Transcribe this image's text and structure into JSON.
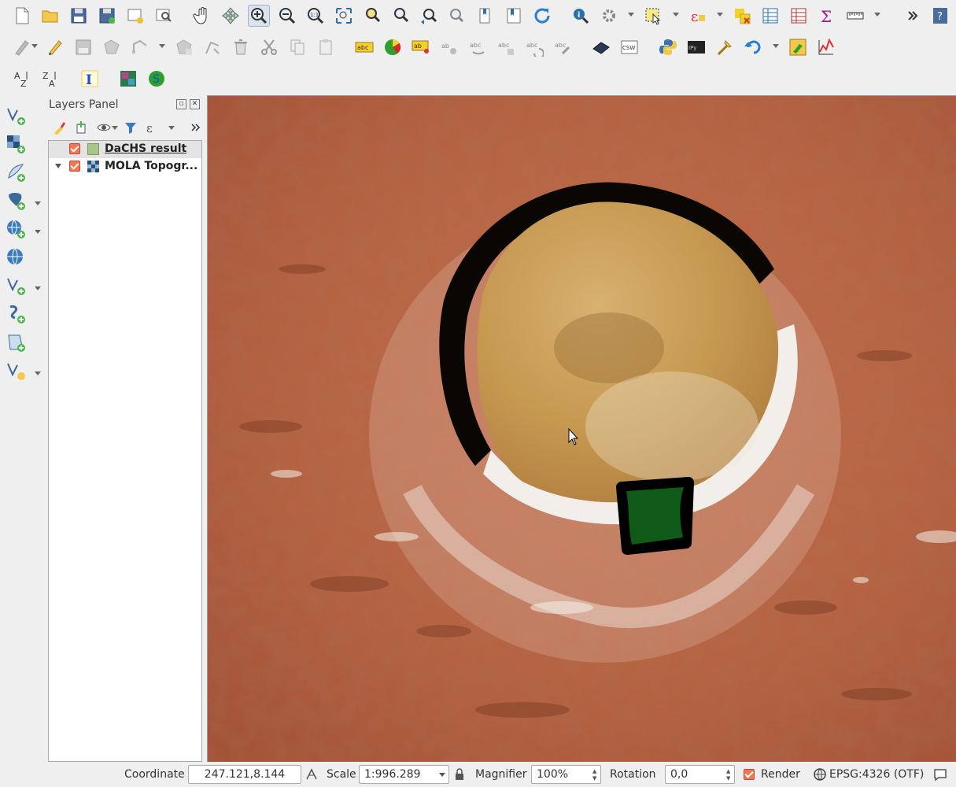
{
  "layers_panel": {
    "title": "Layers Panel",
    "layers": [
      {
        "name": "DaCHS result",
        "visible": true,
        "symbol_color": "#a8c68a",
        "selected": true
      },
      {
        "name": "MOLA Topogr...",
        "visible": true,
        "symbol": "raster-icon",
        "expanded": true
      }
    ]
  },
  "statusbar": {
    "coordinate_label": "Coordinate",
    "coordinate_value": "247.121,8.144",
    "scale_label": "Scale",
    "scale_value": "1:996.289",
    "magnifier_label": "Magnifier",
    "magnifier_value": "100%",
    "rotation_label": "Rotation",
    "rotation_value": "0,0",
    "render_label": "Render",
    "render_checked": true,
    "crs_label": "EPSG:4326 (OTF)"
  },
  "colors": {
    "terrain": "#b05a3c",
    "crater_floor": "#c79a52",
    "polygon_fill": "#0e5a18",
    "polygon_stroke": "#000000",
    "checkbox": "#f3784d"
  },
  "toolbars": {
    "row1_icons": [
      "new-project-icon",
      "open-project-icon",
      "save-project-icon",
      "save-as-icon",
      "new-print-layout-icon",
      "layout-manager-icon",
      "pan-icon",
      "pan-to-selection-icon",
      "zoom-in-icon",
      "zoom-out-icon",
      "zoom-native-icon",
      "zoom-full-icon",
      "zoom-to-selection-icon",
      "zoom-to-layer-icon",
      "zoom-last-icon",
      "zoom-next-icon",
      "new-bookmark-icon",
      "show-bookmarks-icon",
      "refresh-icon",
      "identify-icon",
      "action-icon",
      "select-features-icon",
      "select-by-expression-icon",
      "deselect-icon",
      "attribute-table-icon",
      "field-calculator-icon",
      "statistics-icon",
      "measure-icon",
      "more-icon",
      "help-icon"
    ],
    "row2_icons": [
      "current-edits-icon",
      "toggle-editing-icon",
      "save-edits-icon",
      "add-polygon-icon",
      "vertex-tool-icon",
      "add-ring-icon",
      "node-tool-icon",
      "delete-selected-icon",
      "cut-features-icon",
      "copy-features-icon",
      "paste-features-icon",
      "label-icon",
      "diagram-icon",
      "pin-labels-icon",
      "show-hide-labels-icon",
      "move-label-icon",
      "rotate-label-icon",
      "change-label-icon",
      "metasearch-icon",
      "csw-icon",
      "python-console-icon",
      "ipython-icon",
      "processing-icon",
      "undo-icon",
      "plugin-icon",
      "profile-tool-icon"
    ],
    "row3_icons": [
      "sort-az-icon",
      "sort-za-icon",
      "info-i-icon",
      "mosaic-icon",
      "samp-icon"
    ]
  },
  "left_toolbar_icons": [
    "add-vector-layer-icon",
    "add-raster-layer-icon",
    "add-spatialite-layer-icon",
    "add-postgis-layer-icon",
    "add-wms-layer-icon",
    "add-wcs-layer-icon",
    "add-wfs-layer-icon",
    "add-delimited-text-icon",
    "add-virtual-layer-icon",
    "new-layer-icon"
  ]
}
